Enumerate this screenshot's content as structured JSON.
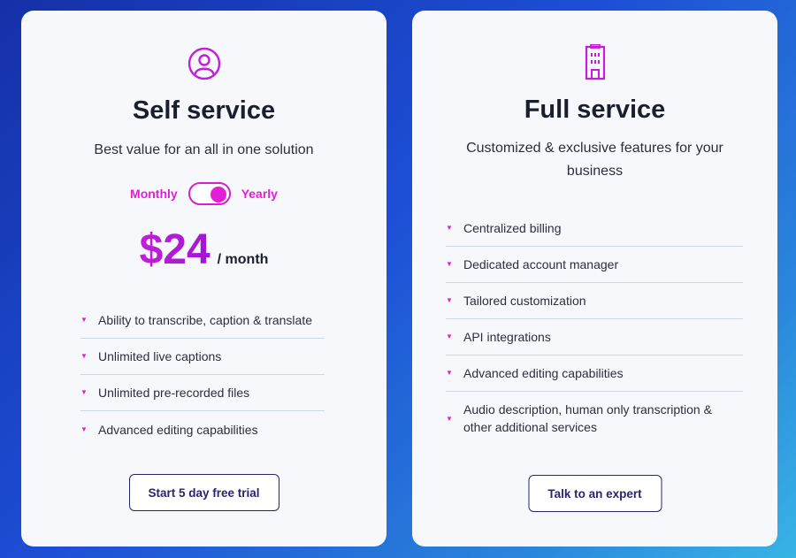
{
  "self_service": {
    "icon": "user-circle-icon",
    "title": "Self service",
    "subtitle": "Best value for an all in one solution",
    "toggle": {
      "left_label": "Monthly",
      "right_label": "Yearly",
      "selected": "Yearly"
    },
    "price": {
      "amount": "$24",
      "period": "/ month"
    },
    "features": [
      "Ability to transcribe, caption & translate",
      "Unlimited live captions",
      "Unlimited pre-recorded files",
      "Advanced editing capabilities"
    ],
    "cta_label": "Start 5 day free trial"
  },
  "full_service": {
    "icon": "building-icon",
    "title": "Full service",
    "subtitle": "Customized & exclusive features for your business",
    "features": [
      "Centralized billing",
      "Dedicated account manager",
      "Tailored customization",
      "API integrations",
      "Advanced editing capabilities",
      "Audio description, human only transcription & other additional services"
    ],
    "cta_label": "Talk to an expert"
  },
  "colors": {
    "accent_magenta": "#e21fd6",
    "button_border": "#2a2470",
    "background_start": "#1530a8",
    "background_end": "#38b4e6"
  }
}
